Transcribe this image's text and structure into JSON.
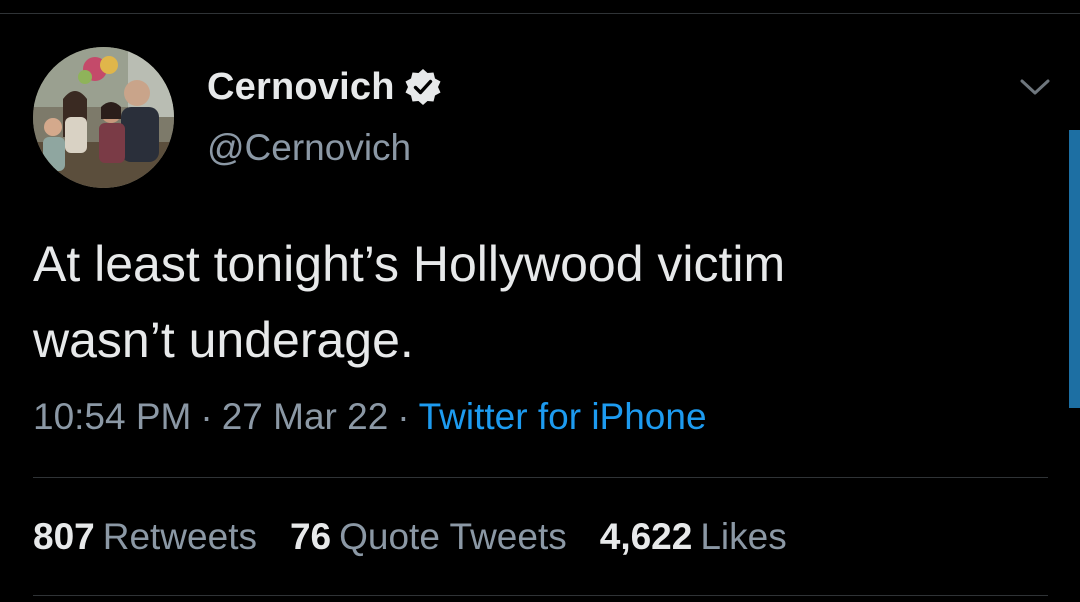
{
  "tweet": {
    "author": {
      "display_name": "Cernovich",
      "handle": "@Cernovich",
      "verified_icon": "verified-badge-icon",
      "avatar": "family-photo"
    },
    "text_lines": [
      "At least tonight’s Hollywood victim",
      "wasn’t underage."
    ],
    "time": "10:54 PM",
    "date": "27 Mar 22",
    "separator": "·",
    "source": "Twitter for iPhone",
    "stats": {
      "retweets_count": "807",
      "retweets_label": "Retweets",
      "quotes_count": "76",
      "quotes_label": "Quote Tweets",
      "likes_count": "4,622",
      "likes_label": "Likes"
    },
    "more_icon": "chevron-down-icon"
  },
  "colors": {
    "background": "#000000",
    "primary_text": "#e7e9ea",
    "secondary_text": "#8b98a5",
    "link": "#1d9bf0",
    "divider": "#2f3336"
  }
}
